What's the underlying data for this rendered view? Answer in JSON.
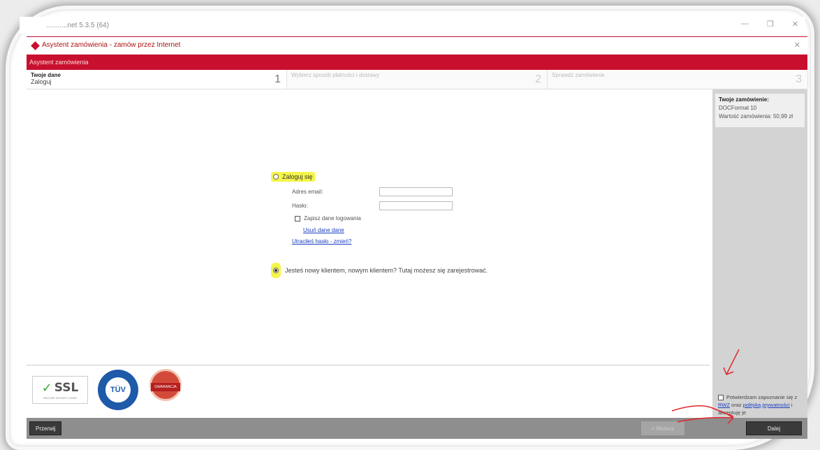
{
  "app": {
    "title": "...........net 5.3.5 (64)"
  },
  "dialog": {
    "title": "Asystent zamówienia - zamów przez Internet"
  },
  "band": {
    "title": "Asystent zamówienia"
  },
  "steps": [
    {
      "title": "Twoje dane",
      "subtitle": "Zaloguj",
      "number": "1"
    },
    {
      "title": "Wybierz sposób płatności i dostawy",
      "subtitle": "",
      "number": "2"
    },
    {
      "title": "Sprawdź zamówienie",
      "subtitle": "",
      "number": "3"
    }
  ],
  "sidebar": {
    "order_title": "Twoje zamówienie:",
    "product": "DOCFormat 10",
    "value_label": "Wartość zamówienia:",
    "value": "50,99 zł",
    "terms": {
      "text_before": "Potwierdzam zapoznanie się z",
      "link1": "RWZ",
      "text_mid": " oraz ",
      "link2": "polityką prywatności",
      "text_after": " i akceptuję je"
    }
  },
  "login": {
    "login_radio_label": "Zaloguj się",
    "email_label": "Adres email:",
    "password_label": "Hasło:",
    "remember_label": "Zapisz dane logowania",
    "forget_link": "Usuń dane dane",
    "forgot_password_link": "Utraciłeś hasło - zmień?",
    "new_client_label": "Jesteś nowy klientem, nowym klientem? Tutaj możesz się zarejestrować."
  },
  "badges": {
    "ssl_text": "SSL",
    "ssl_sub": "SECURE SOCKET LAYER",
    "tuv_text": "TÜV",
    "award_text": "GWARANCJA"
  },
  "footer": {
    "cancel_label": "Przerwij",
    "back_label": "< Wstecz",
    "next_label": "Dalej"
  },
  "colors": {
    "accent": "#c8102e",
    "highlight": "#f5f54a",
    "annotation": "#e0282b"
  }
}
